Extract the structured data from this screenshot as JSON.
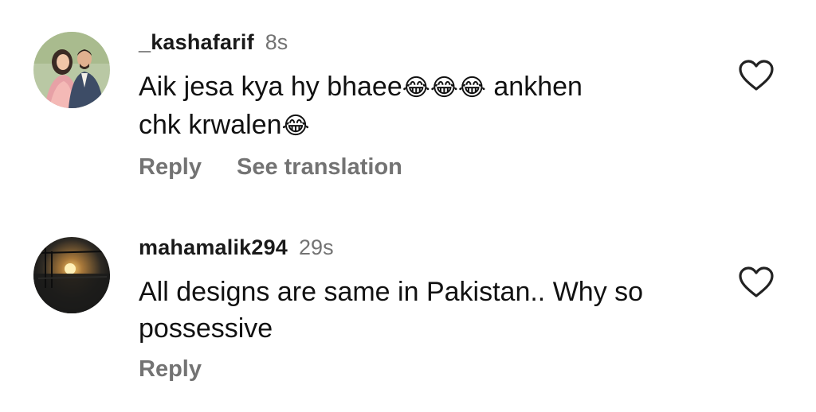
{
  "comments": [
    {
      "username": "_kashafarif",
      "time": "8s",
      "text_part1": "Aik jesa kya hy bhaee",
      "emoji_group": "😂😂😂",
      "text_part2": " ankhen",
      "text_part3": "chk krwalen",
      "emoji_single": "😂",
      "reply_label": "Reply",
      "translation_label": "See translation",
      "like_icon": "heart-outline-icon"
    },
    {
      "username": "mahamalik294",
      "time": "29s",
      "text": "All designs are same in Pakistan.. Why so possessive",
      "reply_label": "Reply",
      "like_icon": "heart-outline-icon"
    }
  ],
  "colors": {
    "text": "#111111",
    "muted": "#737373",
    "background": "#ffffff"
  }
}
